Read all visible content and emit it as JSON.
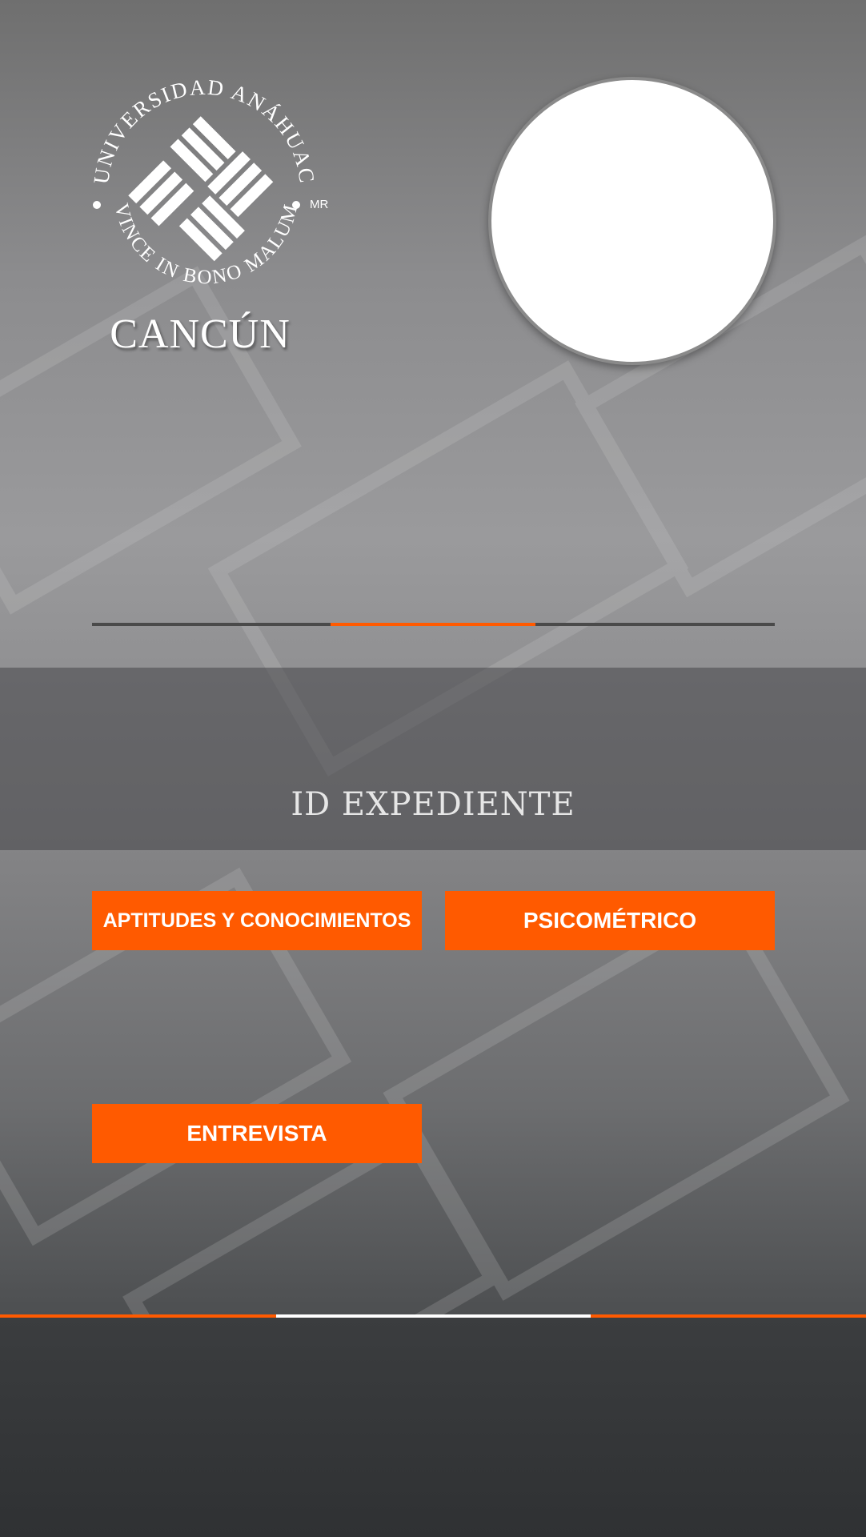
{
  "logo": {
    "university_name": "UNIVERSIDAD ANÁHUAC",
    "motto": "VINCE IN BONO MALUM",
    "mark": "MR",
    "campus": "CANCÚN"
  },
  "profile": {
    "photo_icon": "profile-photo-placeholder"
  },
  "progress": {
    "active_step": 2,
    "total_steps": 3
  },
  "expediente": {
    "label": "ID EXPEDIENTE"
  },
  "buttons": {
    "aptitudes": "APTITUDES Y CONOCIMIENTOS",
    "psicometrico": "PSICOMÉTRICO",
    "entrevista": "ENTREVISTA"
  },
  "colors": {
    "accent": "#ff5a00",
    "text": "#ffffff"
  }
}
